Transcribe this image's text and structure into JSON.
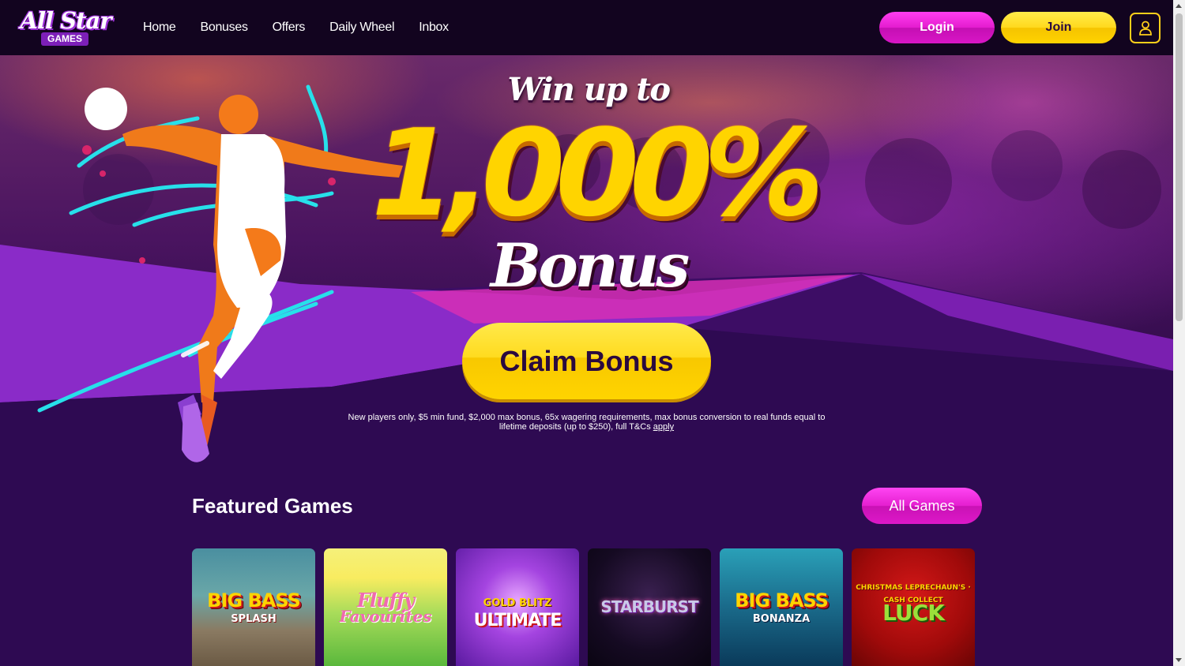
{
  "header": {
    "logo_main": "All Star",
    "logo_sub": "GAMES",
    "nav": [
      "Home",
      "Bonuses",
      "Offers",
      "Daily Wheel",
      "Inbox"
    ],
    "login_label": "Login",
    "join_label": "Join",
    "account_icon": "user-icon"
  },
  "hero": {
    "headline_top": "Win up to",
    "headline_amount": "1,000%",
    "headline_bottom": "Bonus",
    "cta_label": "Claim Bonus",
    "terms_text": "New players only, $5 min fund, $2,000 max bonus, 65x wagering requirements, max bonus conversion to real funds equal to lifetime deposits (up to $250), full T&Cs",
    "terms_link": "apply"
  },
  "featured": {
    "title": "Featured Games",
    "all_games_label": "All Games",
    "games": [
      {
        "title": "BIG BASS",
        "subtitle": "SPLASH"
      },
      {
        "title": "Fluffy",
        "subtitle": "Favourites"
      },
      {
        "title": "ULTIMATE",
        "subtitle": "GOLD BLITZ"
      },
      {
        "title": "STARBURST",
        "subtitle": ""
      },
      {
        "title": "BIG BASS",
        "subtitle": "BONANZA"
      },
      {
        "title": "LUCK",
        "subtitle": "CHRISTMAS LEPRECHAUN'S · CASH COLLECT"
      }
    ]
  },
  "colors": {
    "accent_pink": "#e41ccf",
    "accent_yellow": "#ffd91d",
    "header_bg": "#12041f",
    "page_bg": "#2a0a4a"
  }
}
